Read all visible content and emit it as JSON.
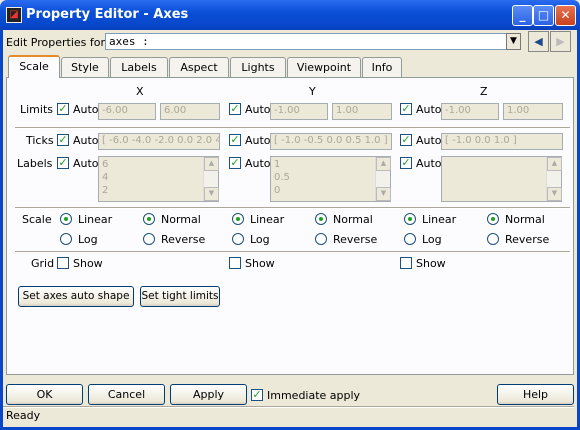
{
  "window": {
    "title": "Property Editor - Axes"
  },
  "edit_for": {
    "label": "Edit Properties for:",
    "value": "axes :"
  },
  "tabs": [
    "Scale",
    "Style",
    "Labels",
    "Aspect",
    "Lights",
    "Viewpoint",
    "Info"
  ],
  "axes_headers": [
    "X",
    "Y",
    "Z"
  ],
  "rows": {
    "limits": "Limits",
    "ticks": "Ticks",
    "labels": "Labels",
    "scale": "Scale",
    "grid": "Grid"
  },
  "auto_label": "Auto",
  "x": {
    "lim_min": "-6.00",
    "lim_max": "6.00",
    "ticks": "[ -6.0 -4.0 -2.0 0.0 2.0 4",
    "labels": [
      "6",
      "4",
      "2"
    ]
  },
  "y": {
    "lim_min": "-1.00",
    "lim_max": "1.00",
    "ticks": "[ -1.0 -0.5 0.0 0.5 1.0 ]",
    "labels": [
      "1",
      "0.5",
      "0"
    ]
  },
  "z": {
    "lim_min": "-1.00",
    "lim_max": "1.00",
    "ticks": "[ -1.0 0.0 1.0 ]",
    "labels": []
  },
  "scale_opts": {
    "linear": "Linear",
    "log": "Log",
    "normal": "Normal",
    "reverse": "Reverse"
  },
  "grid_show": "Show",
  "buttons": {
    "auto_shape": "Set axes auto shape",
    "tight": "Set tight limits",
    "ok": "OK",
    "cancel": "Cancel",
    "apply": "Apply",
    "help": "Help"
  },
  "immediate_apply": "Immediate apply",
  "status": "Ready"
}
